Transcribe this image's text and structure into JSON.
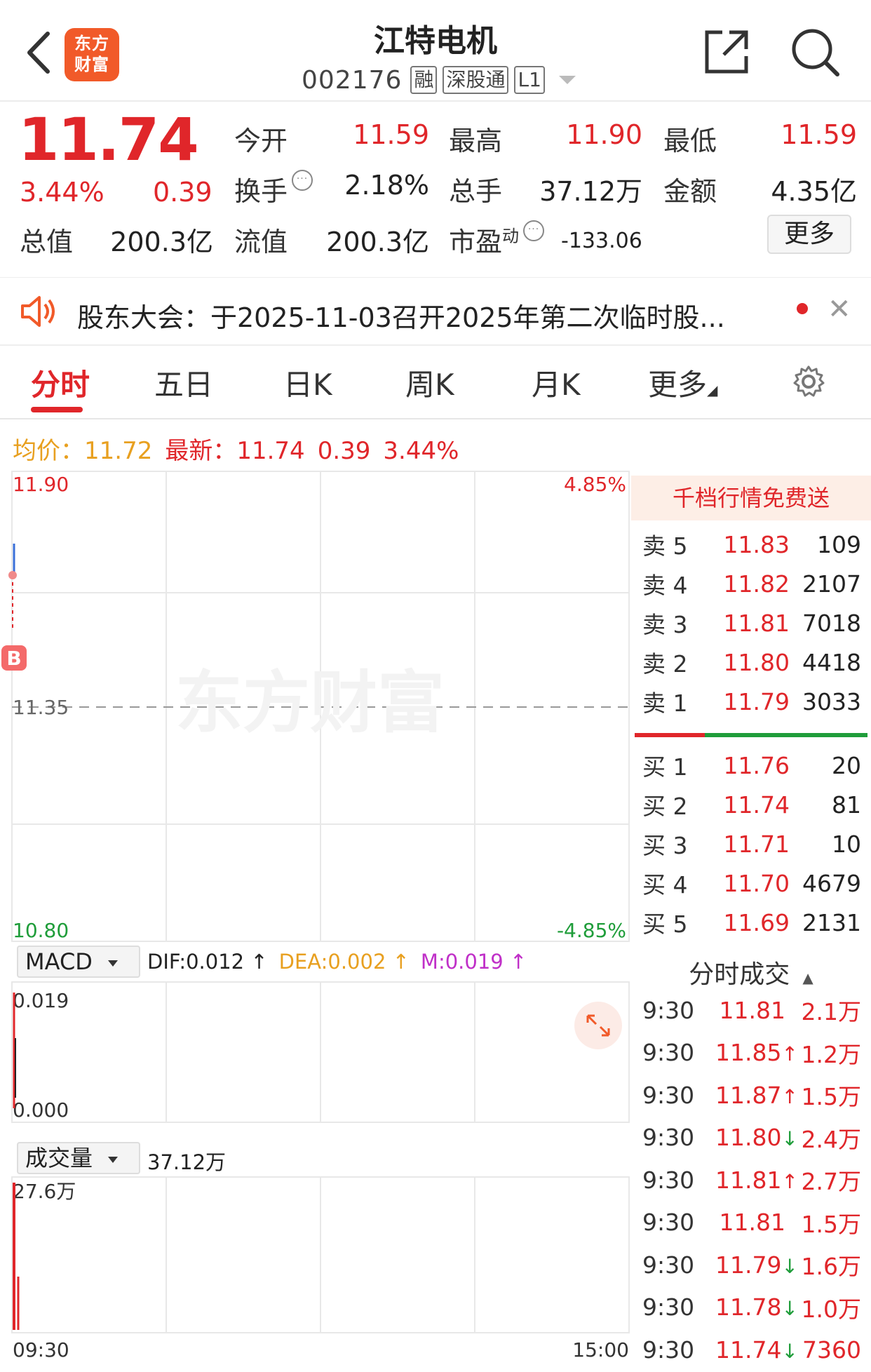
{
  "header": {
    "title": "江特电机",
    "code": "002176",
    "tags": [
      "融",
      "深股通",
      "L1"
    ],
    "logo_line1": "东方",
    "logo_line2": "财富"
  },
  "quote": {
    "price": "11.74",
    "change_pct": "3.44%",
    "change": "0.39",
    "fields": {
      "open_label": "今开",
      "open": "11.59",
      "high_label": "最高",
      "high": "11.90",
      "low_label": "最低",
      "low": "11.59",
      "turnover_label": "换手",
      "turnover": "2.18%",
      "volume_label": "总手",
      "volume": "37.12万",
      "amount_label": "金额",
      "amount": "4.35亿",
      "mcap_label": "总值",
      "mcap": "200.3亿",
      "float_label": "流值",
      "float": "200.3亿",
      "pe_label": "市盈",
      "pe_sup": "动",
      "pe": "-133.06"
    },
    "more_label": "更多"
  },
  "notice": {
    "text": "股东大会：于2025-11-03召开2025年第二次临时股..."
  },
  "tabs": [
    "分时",
    "五日",
    "日K",
    "周K",
    "月K",
    "更多"
  ],
  "active_tab": 0,
  "avg_line": {
    "avg_label": "均价：",
    "avg": "11.72",
    "latest_label": "最新：",
    "latest": "11.74",
    "change": "0.39",
    "change_pct": "3.44%"
  },
  "chart": {
    "y_high": "11.90",
    "y_mid": "11.35",
    "y_low": "10.80",
    "pct_high": "4.85%",
    "pct_low": "-4.85%",
    "watermark": "东方财富",
    "buy_marker": "B",
    "time_start": "09:30",
    "time_end": "15:00",
    "macd": {
      "name": "MACD",
      "dif": "DIF:0.012 ↑",
      "dea": "DEA:0.002 ↑",
      "m": "M:0.019 ↑",
      "y_high": "0.019",
      "y_low": "0.000"
    },
    "volume": {
      "name": "成交量",
      "total": "37.12万",
      "y_high": "27.6万"
    },
    "colors": {
      "up": "#e0262a",
      "down": "#1f9d3a",
      "avg": "#e8a020",
      "line": "#3a6fd8",
      "m": "#c030c8"
    }
  },
  "orderbook": {
    "promo": "千档行情免费送",
    "asks": [
      {
        "label": "卖 5",
        "price": "11.83",
        "vol": "109"
      },
      {
        "label": "卖 4",
        "price": "11.82",
        "vol": "2107"
      },
      {
        "label": "卖 3",
        "price": "11.81",
        "vol": "7018"
      },
      {
        "label": "卖 2",
        "price": "11.80",
        "vol": "4418"
      },
      {
        "label": "卖 1",
        "price": "11.79",
        "vol": "3033"
      }
    ],
    "bids": [
      {
        "label": "买 1",
        "price": "11.76",
        "vol": "20"
      },
      {
        "label": "买 2",
        "price": "11.74",
        "vol": "81"
      },
      {
        "label": "买 3",
        "price": "11.71",
        "vol": "10"
      },
      {
        "label": "买 4",
        "price": "11.70",
        "vol": "4679"
      },
      {
        "label": "买 5",
        "price": "11.69",
        "vol": "2131"
      }
    ]
  },
  "ticks": {
    "title": "分时成交",
    "rows": [
      {
        "time": "9:30",
        "price": "11.81",
        "dir": "",
        "vol": "2.1万"
      },
      {
        "time": "9:30",
        "price": "11.85",
        "dir": "up",
        "vol": "1.2万"
      },
      {
        "time": "9:30",
        "price": "11.87",
        "dir": "up",
        "vol": "1.5万"
      },
      {
        "time": "9:30",
        "price": "11.80",
        "dir": "down",
        "vol": "2.4万"
      },
      {
        "time": "9:30",
        "price": "11.81",
        "dir": "up",
        "vol": "2.7万"
      },
      {
        "time": "9:30",
        "price": "11.81",
        "dir": "",
        "vol": "1.5万"
      },
      {
        "time": "9:30",
        "price": "11.79",
        "dir": "down",
        "vol": "1.6万"
      },
      {
        "time": "9:30",
        "price": "11.78",
        "dir": "down",
        "vol": "1.0万"
      },
      {
        "time": "9:30",
        "price": "11.74",
        "dir": "down",
        "vol": "7360"
      }
    ]
  }
}
